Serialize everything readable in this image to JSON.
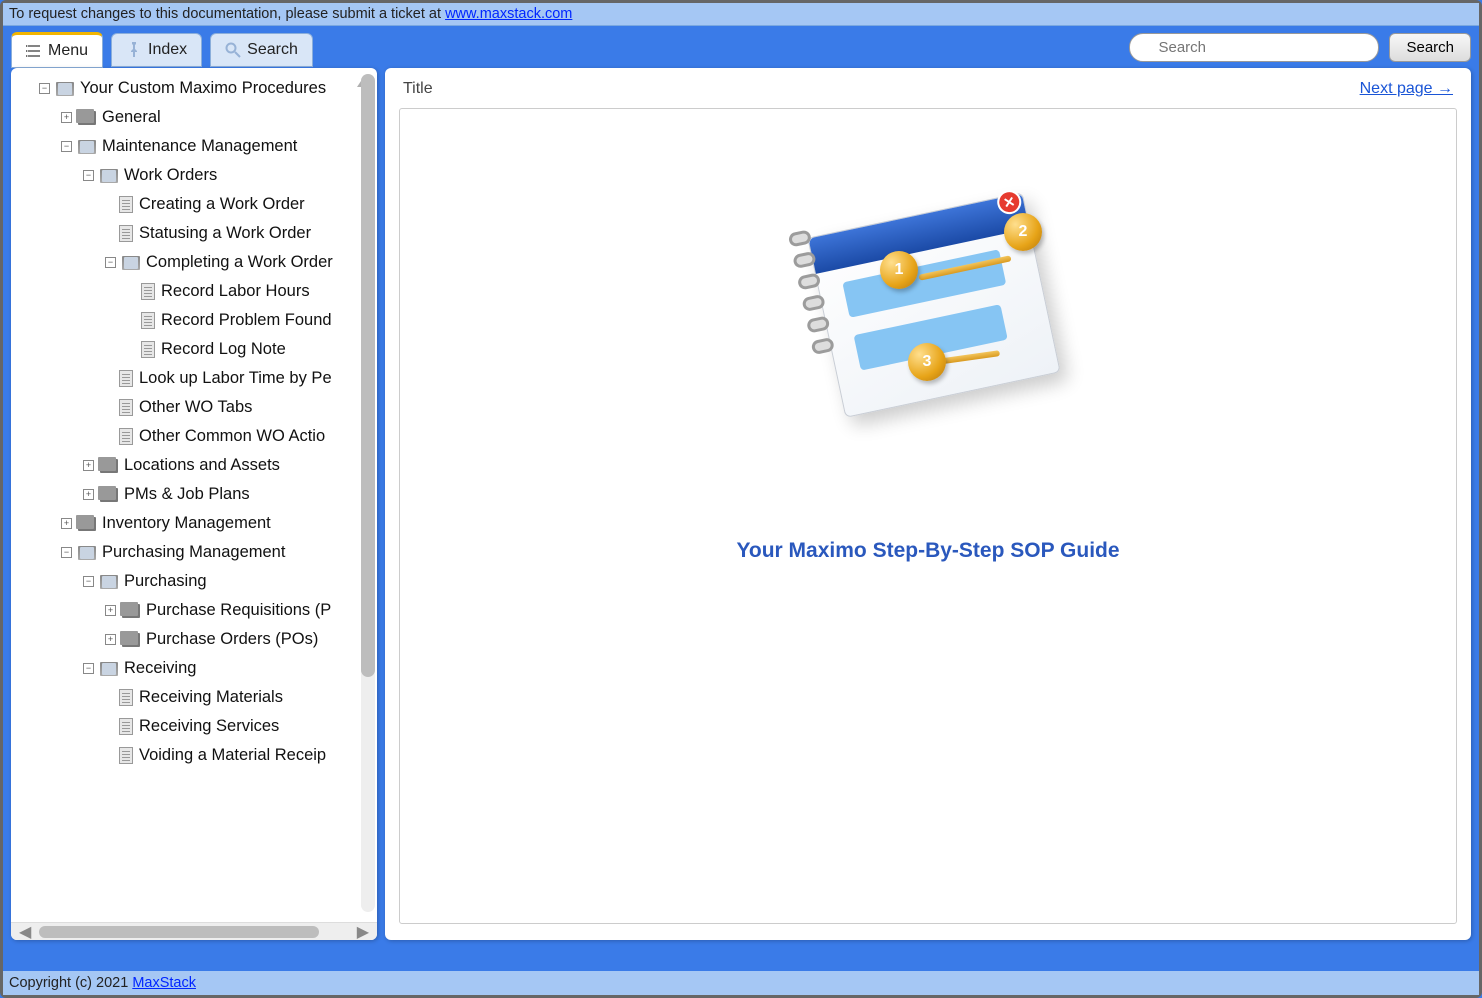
{
  "topbar": {
    "request_text": "To request changes to this documentation, please submit a ticket at ",
    "request_link": "www.maxstack.com"
  },
  "tabs": {
    "menu": "Menu",
    "index": "Index",
    "search": "Search"
  },
  "search": {
    "placeholder": "Search",
    "button": "Search"
  },
  "tree": {
    "root": "Your Custom Maximo Procedures",
    "general": "General",
    "mm": "Maintenance Management",
    "wo": "Work Orders",
    "wo_create": "Creating a Work Order",
    "wo_status": "Statusing a Work Order",
    "wo_complete": "Completing a Work Order",
    "wo_c_labor": "Record Labor Hours",
    "wo_c_problem": "Record Problem Found",
    "wo_c_log": "Record Log Note",
    "wo_labortime": "Look up Labor Time by Pe",
    "wo_tabs": "Other WO Tabs",
    "wo_actions": "Other Common WO Actio",
    "la": "Locations and Assets",
    "pm": "PMs & Job Plans",
    "inv": "Inventory Management",
    "pur_mgmt": "Purchasing Management",
    "pur": "Purchasing",
    "pr": "Purchase Requisitions (P",
    "po": "Purchase Orders (POs)",
    "recv": "Receiving",
    "recv_mat": "Receiving Materials",
    "recv_svc": "Receiving Services",
    "recv_void_mat": "Voiding a Material Receip"
  },
  "content": {
    "title_label": "Title",
    "next_page": "Next page →",
    "heading": "Your Maximo Step-By-Step SOP Guide",
    "ball1": "1",
    "ball2": "2",
    "ball3": "3"
  },
  "footer": {
    "copyright": "Copyright (c) 2021 ",
    "link": "MaxStack"
  }
}
